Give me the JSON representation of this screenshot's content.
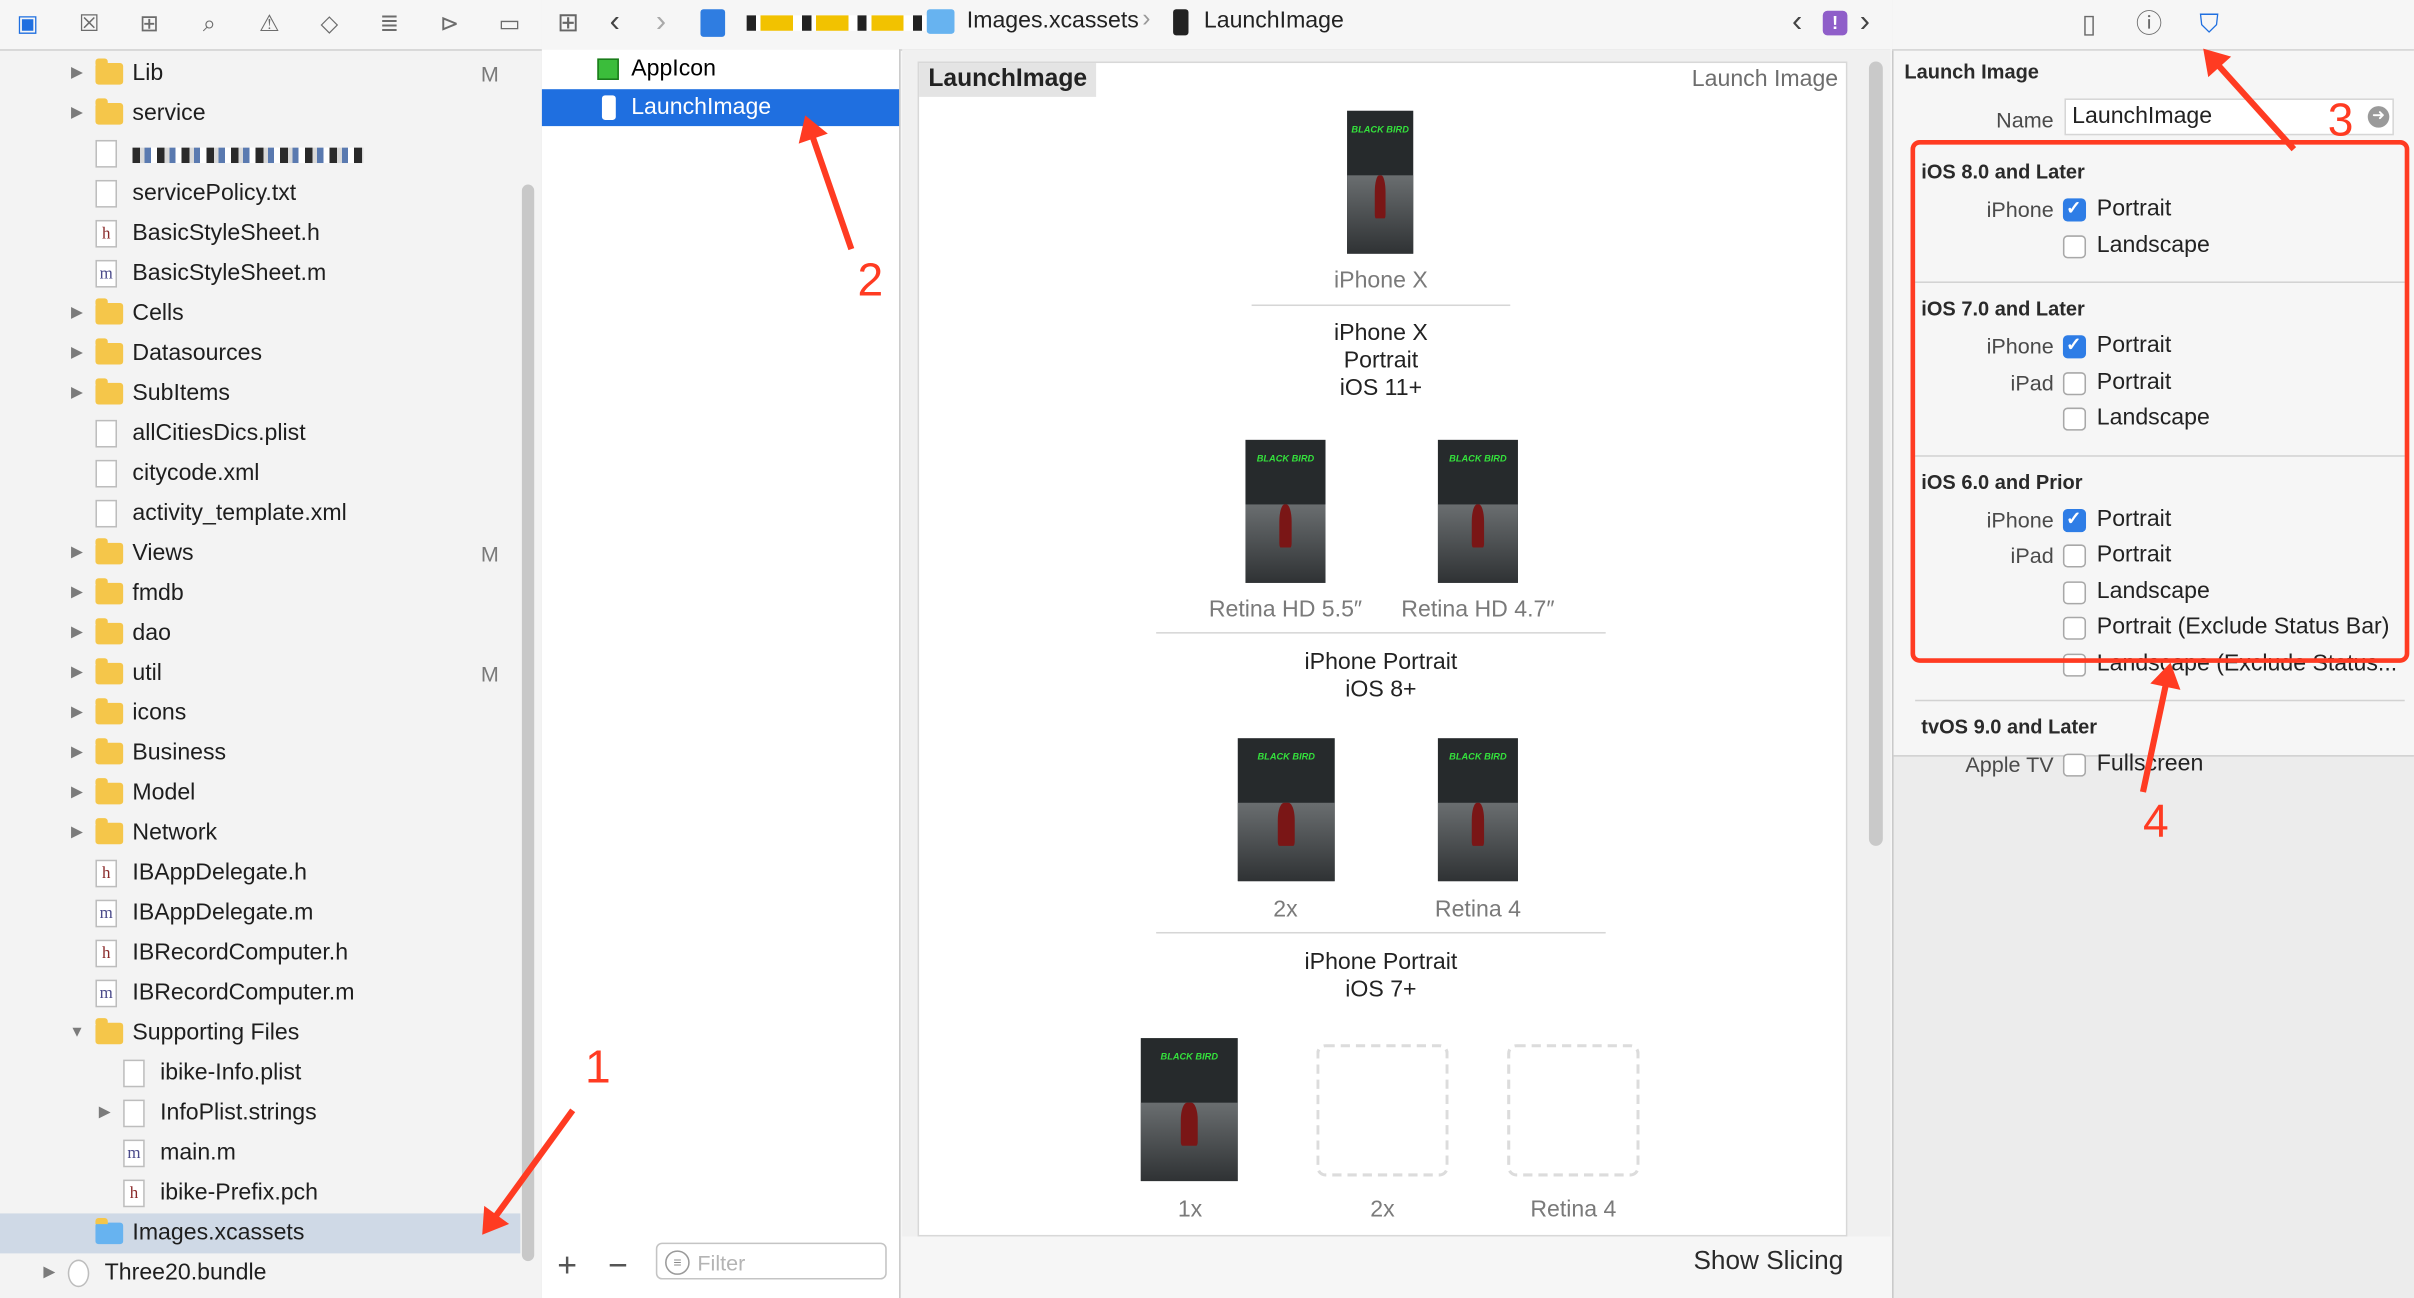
{
  "navigator": {
    "rows": [
      {
        "label": "Lib",
        "kind": "folder",
        "indent": 1,
        "disc": "▶",
        "badge": "M"
      },
      {
        "label": "service",
        "kind": "folder",
        "indent": 1,
        "disc": "▶",
        "badge": ""
      },
      {
        "label": "",
        "kind": "blurred",
        "indent": 1,
        "disc": "",
        "badge": ""
      },
      {
        "label": "servicePolicy.txt",
        "kind": "txt",
        "indent": 1,
        "disc": "",
        "badge": ""
      },
      {
        "label": "BasicStyleSheet.h",
        "kind": "h",
        "indent": 1,
        "disc": "",
        "badge": ""
      },
      {
        "label": "BasicStyleSheet.m",
        "kind": "m",
        "indent": 1,
        "disc": "",
        "badge": ""
      },
      {
        "label": "Cells",
        "kind": "folder",
        "indent": 1,
        "disc": "▶",
        "badge": ""
      },
      {
        "label": "Datasources",
        "kind": "folder",
        "indent": 1,
        "disc": "▶",
        "badge": ""
      },
      {
        "label": "SubItems",
        "kind": "folder",
        "indent": 1,
        "disc": "▶",
        "badge": ""
      },
      {
        "label": "allCitiesDics.plist",
        "kind": "txt",
        "indent": 1,
        "disc": "",
        "badge": ""
      },
      {
        "label": "citycode.xml",
        "kind": "txt",
        "indent": 1,
        "disc": "",
        "badge": ""
      },
      {
        "label": "activity_template.xml",
        "kind": "txt",
        "indent": 1,
        "disc": "",
        "badge": ""
      },
      {
        "label": "Views",
        "kind": "folder",
        "indent": 1,
        "disc": "▶",
        "badge": "M"
      },
      {
        "label": "fmdb",
        "kind": "folder",
        "indent": 1,
        "disc": "▶",
        "badge": ""
      },
      {
        "label": "dao",
        "kind": "folder",
        "indent": 1,
        "disc": "▶",
        "badge": ""
      },
      {
        "label": "util",
        "kind": "folder",
        "indent": 1,
        "disc": "▶",
        "badge": "M"
      },
      {
        "label": "icons",
        "kind": "folder",
        "indent": 1,
        "disc": "▶",
        "badge": ""
      },
      {
        "label": "Business",
        "kind": "folder",
        "indent": 1,
        "disc": "▶",
        "badge": ""
      },
      {
        "label": "Model",
        "kind": "folder",
        "indent": 1,
        "disc": "▶",
        "badge": ""
      },
      {
        "label": "Network",
        "kind": "folder",
        "indent": 1,
        "disc": "▶",
        "badge": ""
      },
      {
        "label": "IBAppDelegate.h",
        "kind": "h",
        "indent": 1,
        "disc": "",
        "badge": ""
      },
      {
        "label": "IBAppDelegate.m",
        "kind": "m",
        "indent": 1,
        "disc": "",
        "badge": ""
      },
      {
        "label": "IBRecordComputer.h",
        "kind": "h",
        "indent": 1,
        "disc": "",
        "badge": ""
      },
      {
        "label": "IBRecordComputer.m",
        "kind": "m",
        "indent": 1,
        "disc": "",
        "badge": ""
      },
      {
        "label": "Supporting Files",
        "kind": "folder",
        "indent": 1,
        "disc": "▼",
        "badge": ""
      },
      {
        "label": "ibike-Info.plist",
        "kind": "txt",
        "indent": 2,
        "disc": "",
        "badge": ""
      },
      {
        "label": "InfoPlist.strings",
        "kind": "txt",
        "indent": 2,
        "disc": "▶",
        "badge": ""
      },
      {
        "label": "main.m",
        "kind": "m",
        "indent": 2,
        "disc": "",
        "badge": ""
      },
      {
        "label": "ibike-Prefix.pch",
        "kind": "h",
        "indent": 2,
        "disc": "",
        "badge": ""
      },
      {
        "label": "Images.xcassets",
        "kind": "xcassets",
        "indent": 1,
        "disc": "",
        "badge": ""
      },
      {
        "label": "Three20.bundle",
        "kind": "bundle",
        "indent": 0,
        "disc": "▶",
        "badge": ""
      }
    ]
  },
  "breadcrumb": {
    "folder": "Images.xcassets",
    "item": "LaunchImage"
  },
  "asset_list": {
    "items": [
      "AppIcon",
      "LaunchImage"
    ],
    "filter_placeholder": "Filter"
  },
  "editor": {
    "set_name": "LaunchImage",
    "set_type": "Launch Image",
    "slots": {
      "iphonex": "iPhone X",
      "hd55": "Retina HD 5.5″",
      "hd47": "Retina HD 4.7″",
      "p8_2x": "2x",
      "p8_r4": "Retina 4",
      "p7_1x": "1x",
      "p7_2x": "2x",
      "p7_r4": "Retina 4"
    },
    "groups": {
      "g1": "iPhone X\nPortrait\niOS 11+",
      "g2": "iPhone Portrait\niOS 8+",
      "g3": "iPhone Portrait\niOS 7+"
    },
    "thumb_text": "BLACK BIRD",
    "show_slicing": "Show Slicing"
  },
  "inspector": {
    "title": "Launch Image",
    "name_label": "Name",
    "name_value": "LaunchImage",
    "sections": [
      {
        "header": "iOS 8.0 and Later",
        "rows": [
          {
            "device": "iPhone",
            "label": "Portrait",
            "checked": true
          },
          {
            "device": "",
            "label": "Landscape",
            "checked": false
          }
        ]
      },
      {
        "header": "iOS 7.0 and Later",
        "rows": [
          {
            "device": "iPhone",
            "label": "Portrait",
            "checked": true
          },
          {
            "device": "iPad",
            "label": "Portrait",
            "checked": false
          },
          {
            "device": "",
            "label": "Landscape",
            "checked": false
          }
        ]
      },
      {
        "header": "iOS 6.0 and Prior",
        "rows": [
          {
            "device": "iPhone",
            "label": "Portrait",
            "checked": true
          },
          {
            "device": "iPad",
            "label": "Portrait",
            "checked": false
          },
          {
            "device": "",
            "label": "Landscape",
            "checked": false
          },
          {
            "device": "",
            "label": "Portrait (Exclude Status Bar)",
            "checked": false
          },
          {
            "device": "",
            "label": "Landscape (Exclude Status...",
            "checked": false
          }
        ]
      },
      {
        "header": "tvOS 9.0 and Later",
        "rows": [
          {
            "device": "Apple TV",
            "label": "Fullscreen",
            "checked": false
          }
        ]
      }
    ]
  },
  "annotations": {
    "a1": "1",
    "a2": "2",
    "a3": "3",
    "a4": "4"
  },
  "colors": {
    "accent": "#1f6fe0",
    "annotation": "#ff3b22",
    "folder": "#f5c64a"
  }
}
